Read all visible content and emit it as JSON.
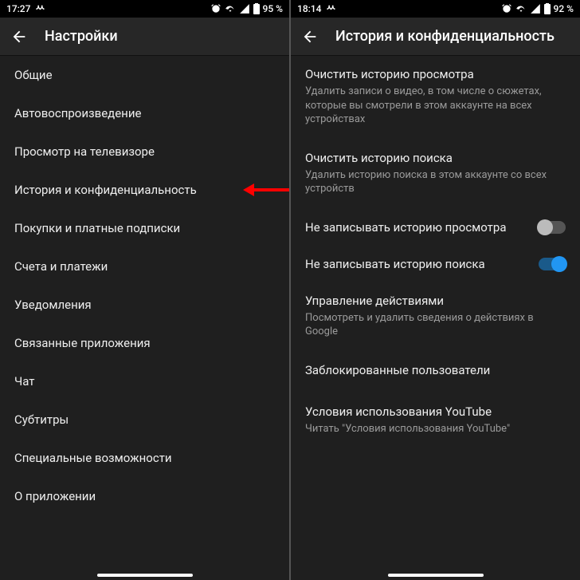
{
  "left": {
    "status": {
      "time": "17:27",
      "battery": "95 %"
    },
    "title": "Настройки",
    "items": [
      "Общие",
      "Автовоспроизведение",
      "Просмотр на телевизоре",
      "История и конфиденциальность",
      "Покупки и платные подписки",
      "Счета и платежи",
      "Уведомления",
      "Связанные приложения",
      "Чат",
      "Субтитры",
      "Специальные возможности",
      "О приложении"
    ],
    "highlighted_index": 3
  },
  "right": {
    "status": {
      "time": "18:14",
      "battery": "92 %"
    },
    "title": "История и конфиденциальность",
    "sections": [
      {
        "title": "Очистить историю просмотра",
        "sub": "Удалить записи о видео, в том числе о сюжетах, которые вы смотрели в этом аккаунте на всех устройствах"
      },
      {
        "title": "Очистить историю поиска",
        "sub": "Удалить историю поиска в этом аккаунте со всех устройств"
      }
    ],
    "toggles": [
      {
        "label": "Не записывать историю просмотра",
        "on": false
      },
      {
        "label": "Не записывать историю поиска",
        "on": true
      }
    ],
    "sections2": [
      {
        "title": "Управление действиями",
        "sub": "Посмотреть и удалить сведения о действиях в Google"
      },
      {
        "title": "Заблокированные пользователи",
        "sub": ""
      },
      {
        "title": "Условия использования YouTube",
        "sub": "Читать \"Условия использования YouTube\""
      }
    ]
  }
}
